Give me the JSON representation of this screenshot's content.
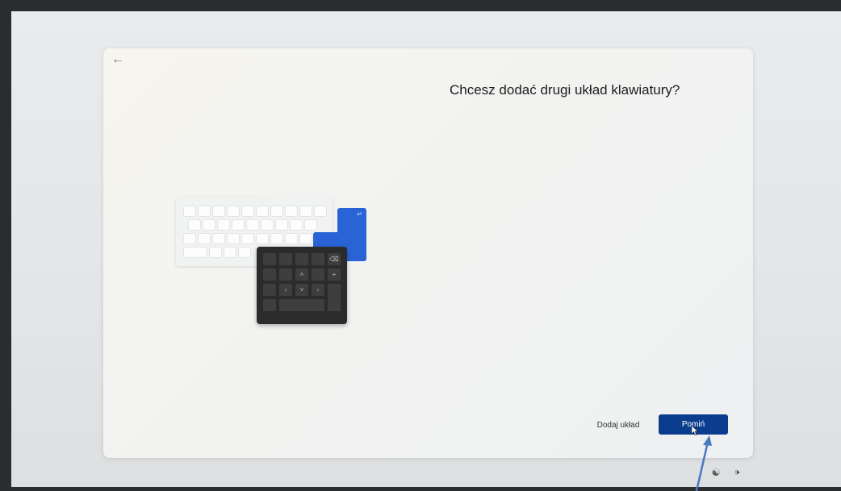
{
  "setup": {
    "title": "Chcesz dodać drugi układ klawiatury?",
    "back_icon": "arrow-left-icon",
    "add_layout_label": "Dodaj układ",
    "skip_label": "Pomiń"
  },
  "taskbar": {
    "accessibility_icon": "accessibility-icon",
    "volume_icon": "volume-icon"
  },
  "colors": {
    "primary_button": "#0b3d8f",
    "illustration_blue": "#2a63d6",
    "numpad": "#2b2b2b",
    "annotation_arrow": "#4a78c0"
  }
}
